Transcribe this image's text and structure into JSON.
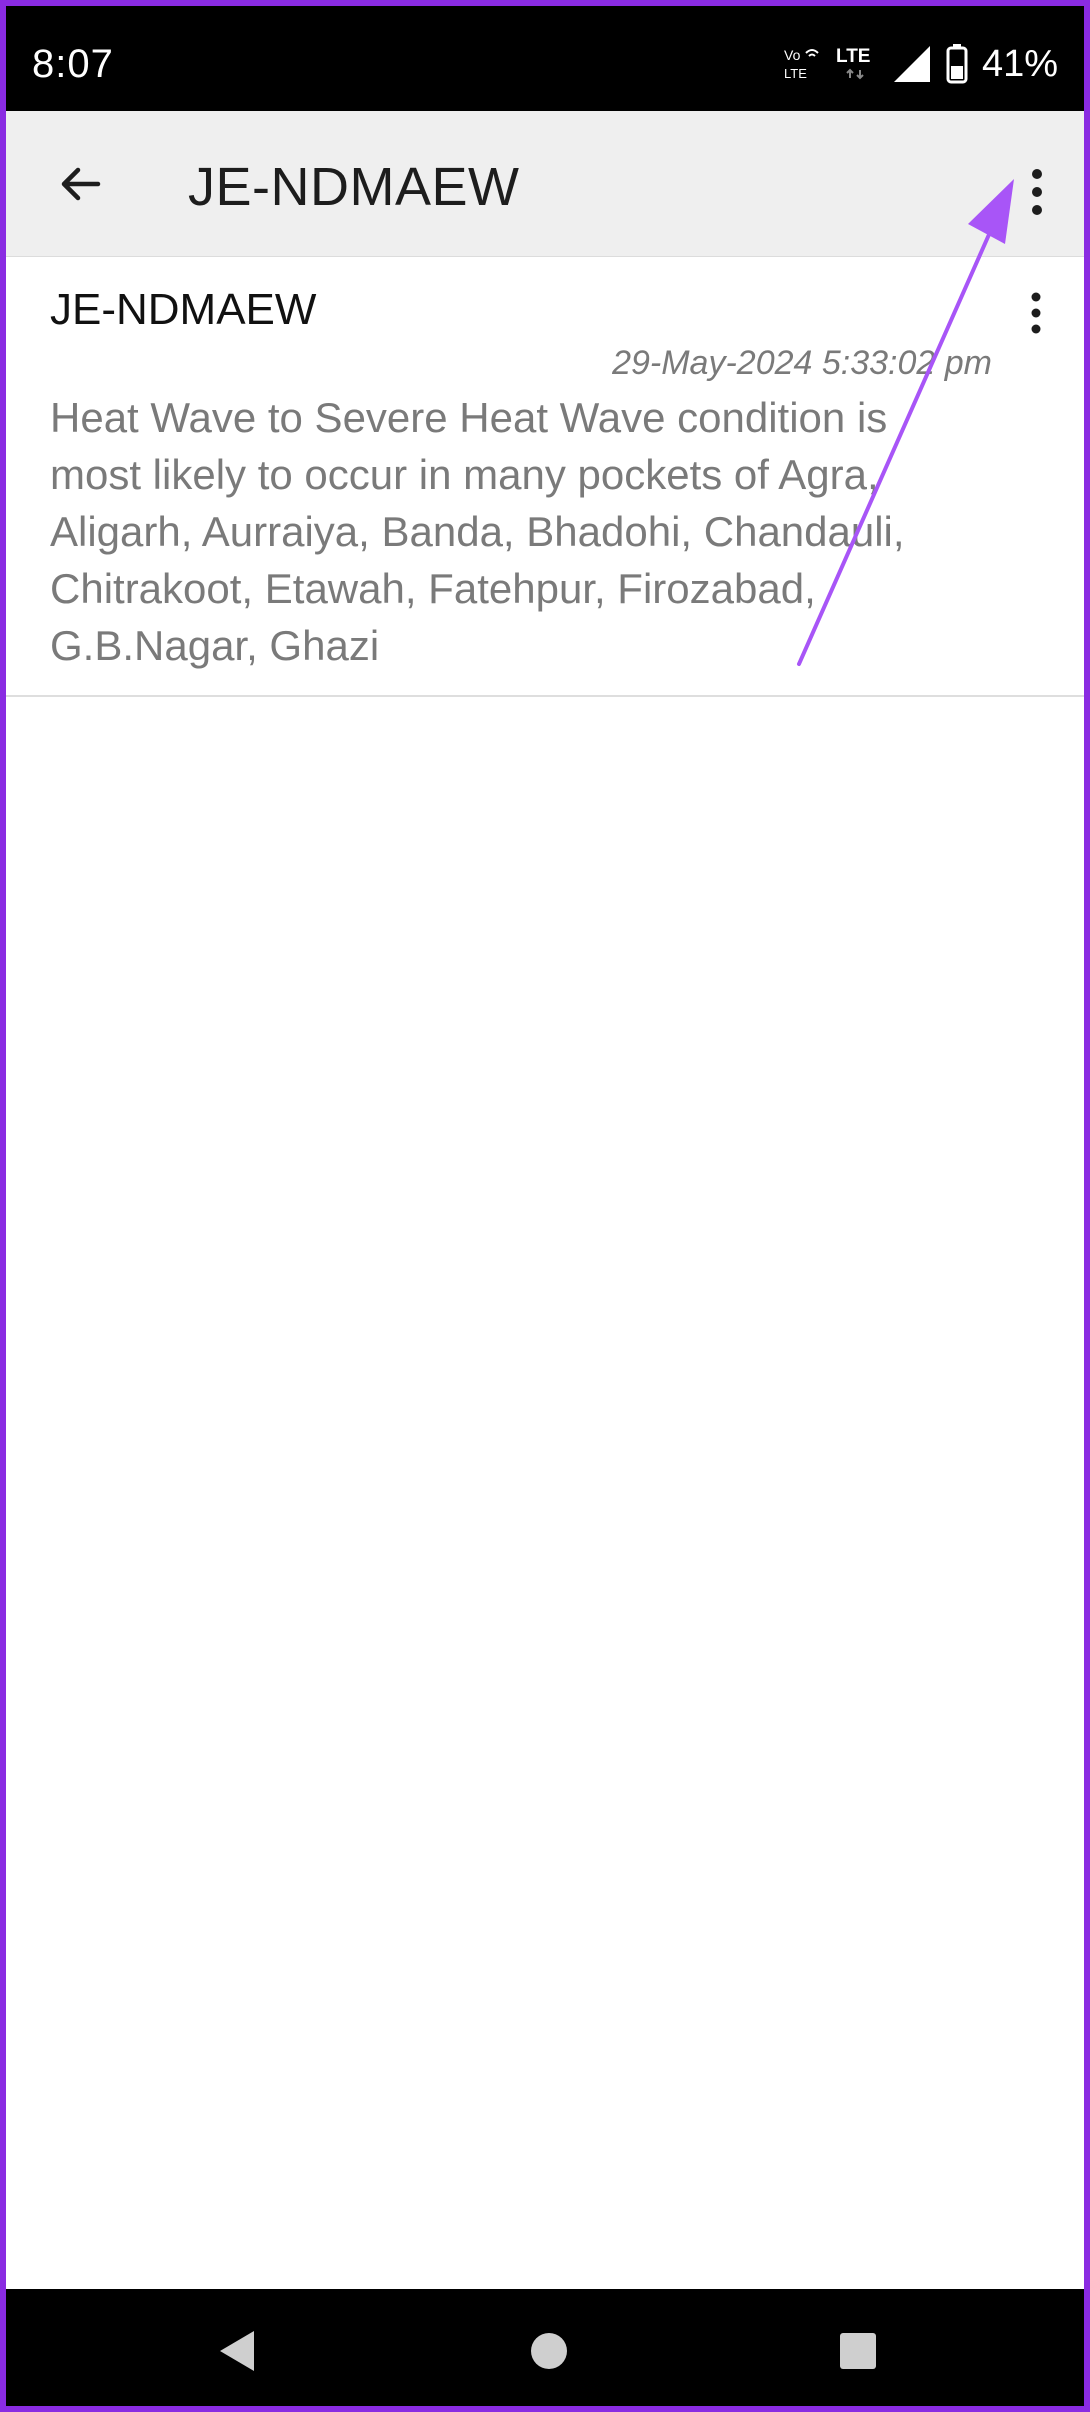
{
  "status_bar": {
    "time": "8:07",
    "volte_top": "Vo",
    "volte_bottom": "LTE",
    "network": "LTE",
    "battery_percent": "41%"
  },
  "app_bar": {
    "title": "JE-NDMAEW",
    "back_icon": "arrow-back-icon",
    "overflow_icon": "more-vert-icon"
  },
  "messages": [
    {
      "sender": "JE-NDMAEW",
      "timestamp": "29-May-2024 5:33:02 pm",
      "body": "Heat Wave to Severe Heat Wave condition is most likely to occur in many pockets of Agra, Aligarh, Aurraiya, Banda, Bhadohi, Chandauli, Chitrakoot, Etawah, Fatehpur, Firozabad, G.B.Nagar, Ghazi"
    }
  ],
  "colors": {
    "accent_border": "#8a2be2",
    "annotation_arrow": "#a855f7",
    "app_bar_bg": "#efefef",
    "secondary_text": "#7a7a7a"
  }
}
